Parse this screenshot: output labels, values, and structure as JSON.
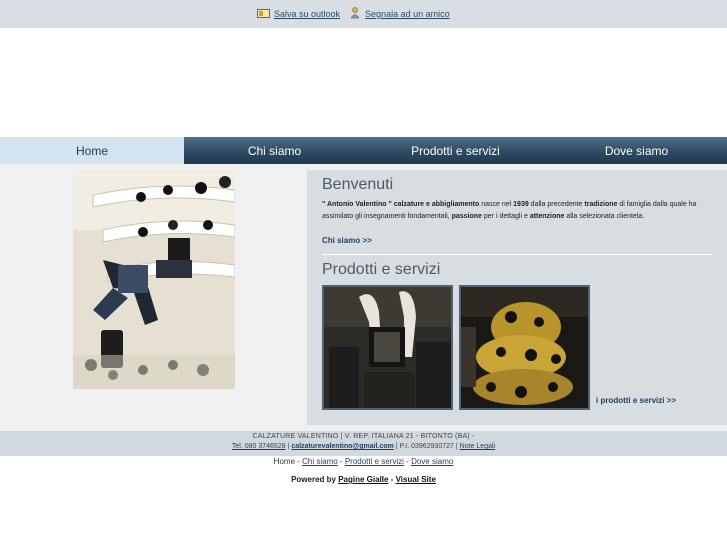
{
  "toplinks": {
    "outlook_label": "Salva su outlook",
    "friend_label": "Segnala ad un amico"
  },
  "nav": {
    "items": [
      {
        "label": "Home"
      },
      {
        "label": "Chi siamo"
      },
      {
        "label": "Prodotti e servizi"
      },
      {
        "label": "Dove siamo"
      }
    ]
  },
  "welcome": {
    "title": "Benvenuti",
    "text_brand": "\" Antonio Valentino \" calzature e abbigliamento",
    "text_1": " nasce nel ",
    "year": "1939",
    "text_2": " dalla precedente ",
    "text_tradition": "tradizione",
    "text_3": " di famiglia dalla quale ha assimilato gli insegnamenti fondamentali, ",
    "text_passion": "passione",
    "text_4": " per i dettagli e ",
    "text_attention": "attenzione",
    "text_5": " alla selezionata clientela.",
    "more_label": "Chi siamo >>"
  },
  "products": {
    "title": "Prodotti e servizi",
    "more_label": "i prodotti e servizi >>"
  },
  "footer": {
    "company_line": "CALZATURE VALENTINO | V. REP. ITALIANA 21 - BITONTO (BA) -",
    "phone": "Tel. 080 3746528",
    "email": "calzaturevalentino@gmail.com",
    "vat": "P.I. 03962930727",
    "legal": "Note Legali"
  },
  "footnav": {
    "home": "Home",
    "chi_siamo": "Chi siamo",
    "prodotti": "Prodotti e servizi",
    "dove": "Dove siamo"
  },
  "powered": {
    "label": "Powered by",
    "pagine": "Pagine Gialle",
    "visual": "Visual Site"
  }
}
